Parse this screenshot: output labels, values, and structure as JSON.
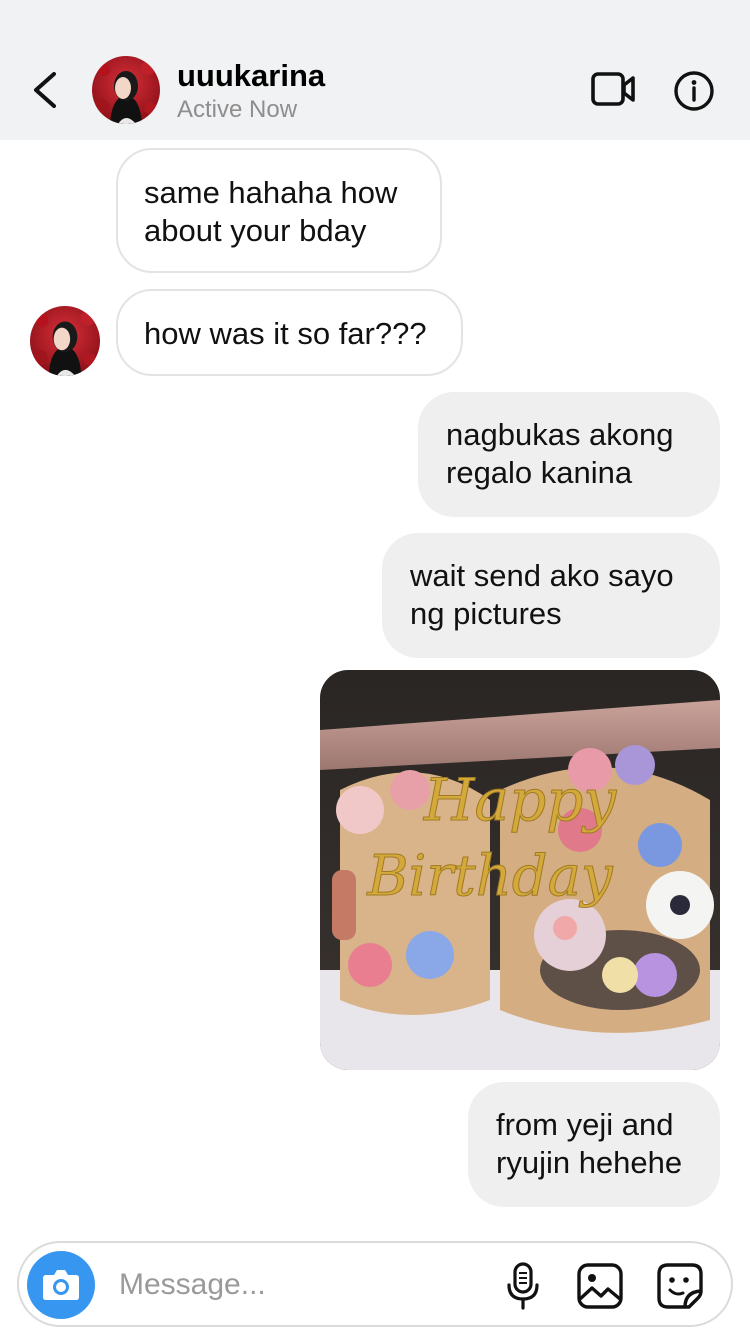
{
  "header": {
    "username": "uuukarina",
    "status": "Active Now",
    "icons": {
      "back": "chevron-left-icon",
      "video": "video-camera-icon",
      "info": "info-icon"
    }
  },
  "messages": [
    {
      "from": "them",
      "text": "same hahaha how\nabout your bday"
    },
    {
      "from": "them",
      "text": "how was it so far???"
    },
    {
      "from": "me",
      "text": "nagbukas akong\nregalo kanina"
    },
    {
      "from": "me",
      "text": "wait send ako sayo\nng pictures"
    },
    {
      "from": "me",
      "type": "photo",
      "text": "Happy Birthday"
    },
    {
      "from": "me",
      "text": "from yeji and\nryujin hehehe"
    }
  ],
  "composer": {
    "placeholder": "Message...",
    "icons": {
      "camera": "camera-icon",
      "mic": "microphone-icon",
      "gallery": "image-icon",
      "sticker": "sticker-icon"
    }
  },
  "colors": {
    "header_bg": "#f1f2f3",
    "outgoing_bubble": "#efefef",
    "camera_button": "#3797f0",
    "status_text": "#8e8e8e"
  }
}
